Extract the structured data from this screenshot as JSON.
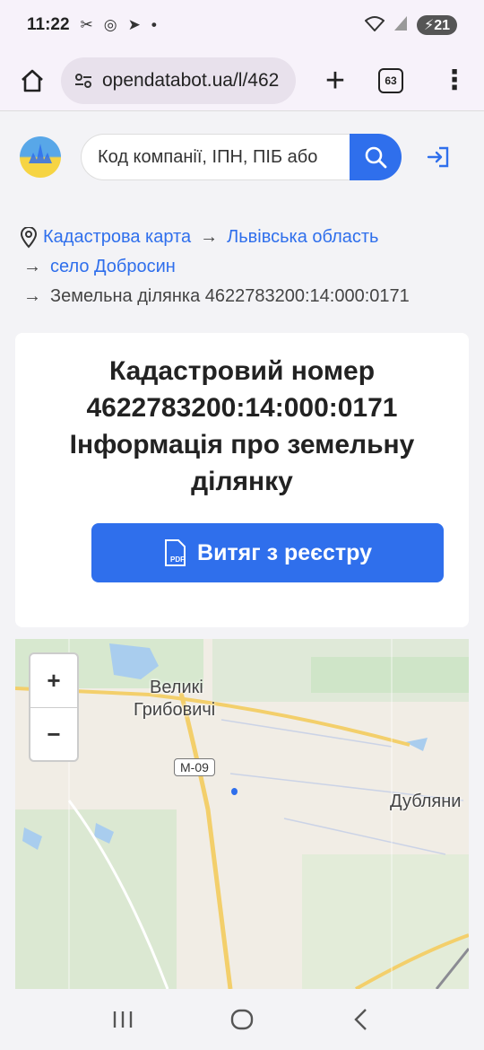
{
  "status_bar": {
    "time": "11:22",
    "battery": "21"
  },
  "browser": {
    "url": "opendatabot.ua/l/462",
    "tabs_count": "63"
  },
  "header": {
    "search_placeholder": "Код компанії, ІПН, ПІБ або"
  },
  "breadcrumb": {
    "items": [
      "Кадастрова карта",
      "Львівська область",
      "село Добросин"
    ],
    "arrow": "→",
    "current": "Земельна ділянка 4622783200:14:000:0171"
  },
  "card": {
    "title_line1": "Кадастровий номер",
    "title_line2": "4622783200:14:000:0171",
    "title_line3": "Інформація про земельну",
    "title_line4": "ділянку",
    "pdf_button_label": "Витяг з реєстру",
    "pdf_badge": "PDF"
  },
  "map": {
    "zoom_in": "+",
    "zoom_out": "−",
    "labels": {
      "village1_line1": "Великі",
      "village1_line2": "Грибовичі",
      "village2": "Дубляни",
      "road": "М-09"
    }
  },
  "colors": {
    "accent": "#2f6fec",
    "background": "#f3f3f6"
  }
}
